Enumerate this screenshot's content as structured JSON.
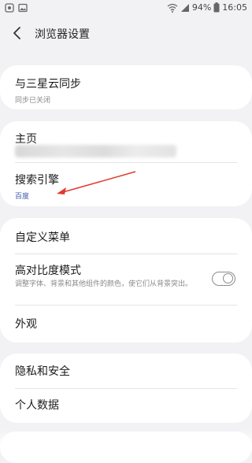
{
  "status_bar": {
    "battery_percent": "94%",
    "time": "16:05"
  },
  "header": {
    "title": "浏览器设置"
  },
  "settings": {
    "sync": {
      "title": "与三星云同步",
      "subtitle": "同步已关闭"
    },
    "homepage": {
      "title": "主页"
    },
    "search_engine": {
      "title": "搜索引擎",
      "value": "百度"
    },
    "custom_menu": {
      "title": "自定义菜单"
    },
    "high_contrast": {
      "title": "高对比度模式",
      "description": "调整字体、背景和其他组件的颜色，使它们从背景突出。",
      "enabled": false
    },
    "appearance": {
      "title": "外观"
    },
    "privacy": {
      "title": "隐私和安全"
    },
    "personal_data": {
      "title": "个人数据"
    }
  },
  "colors": {
    "accent": "#3e59a6",
    "background": "#f2f2f4",
    "card": "#ffffff",
    "annotation_arrow": "#e23a2e"
  }
}
